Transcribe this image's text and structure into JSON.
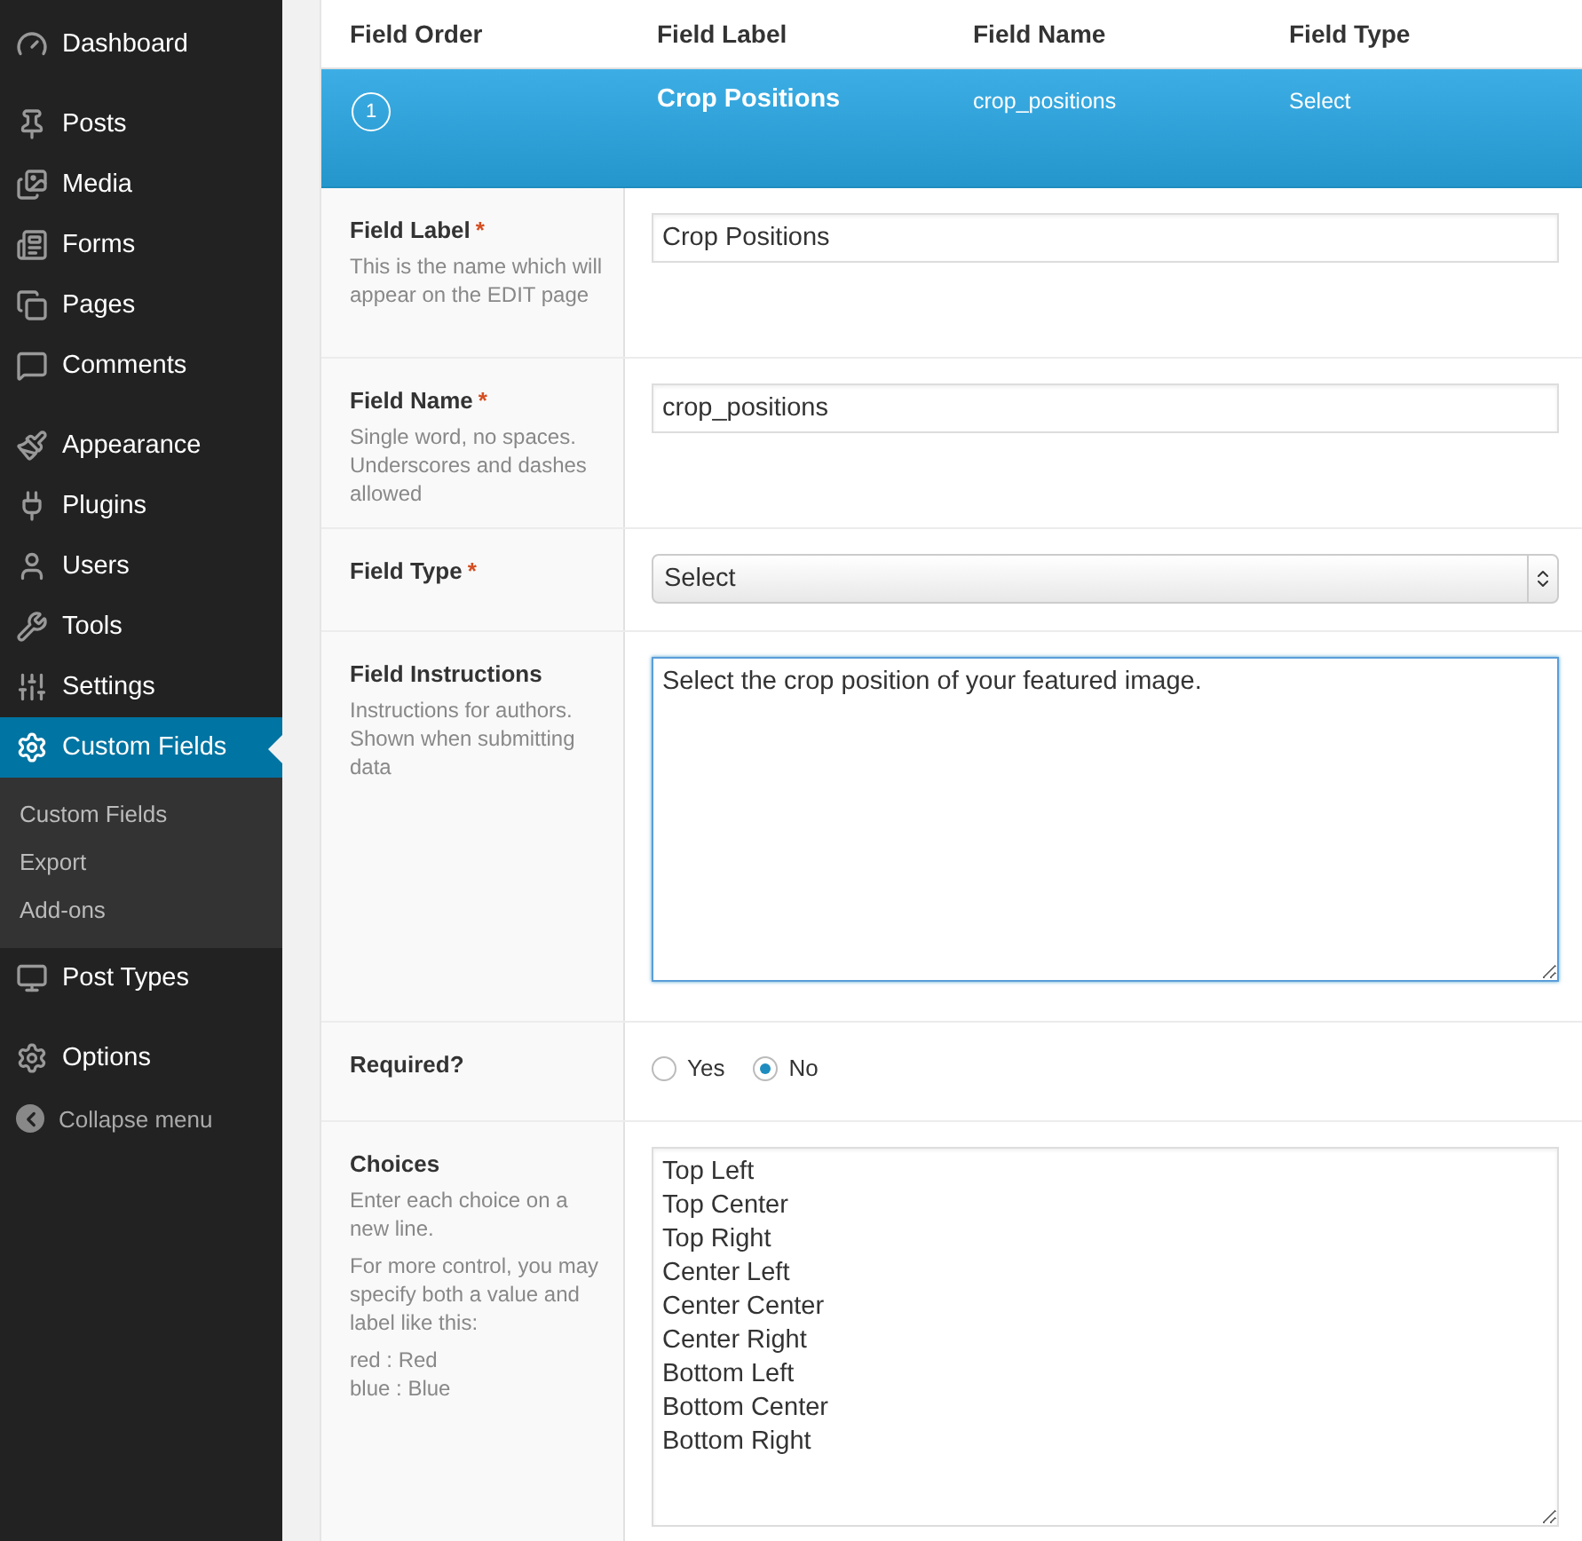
{
  "sidebar": {
    "groups": [
      [
        {
          "label": "Dashboard",
          "kind": "gauge",
          "selected": false
        }
      ],
      [
        {
          "label": "Posts",
          "kind": "pin",
          "selected": false
        },
        {
          "label": "Media",
          "kind": "media",
          "selected": false
        },
        {
          "label": "Forms",
          "kind": "form",
          "selected": false
        },
        {
          "label": "Pages",
          "kind": "pages",
          "selected": false
        },
        {
          "label": "Comments",
          "kind": "comment",
          "selected": false
        }
      ],
      [
        {
          "label": "Appearance",
          "kind": "brush",
          "selected": false
        },
        {
          "label": "Plugins",
          "kind": "plug",
          "selected": false
        },
        {
          "label": "Users",
          "kind": "user",
          "selected": false
        },
        {
          "label": "Tools",
          "kind": "wrench",
          "selected": false
        },
        {
          "label": "Settings",
          "kind": "sliders",
          "selected": false
        },
        {
          "label": "Custom Fields",
          "kind": "gear",
          "selected": true,
          "children": [
            {
              "label": "Custom Fields",
              "selected": false
            },
            {
              "label": "Export",
              "selected": false
            },
            {
              "label": "Add-ons",
              "selected": false
            }
          ]
        },
        {
          "label": "Post Types",
          "kind": "screen",
          "selected": false
        }
      ],
      [
        {
          "label": "Options",
          "kind": "gear",
          "selected": false
        }
      ]
    ],
    "collapse": "Collapse menu"
  },
  "fields_table": {
    "columns": [
      "Field Order",
      "Field Label",
      "Field Name",
      "Field Type"
    ],
    "open_field": {
      "order": "1",
      "label": "Crop Positions",
      "name": "crop_positions",
      "type": "Select"
    }
  },
  "form": [
    {
      "kind": "text",
      "label": "Field Label",
      "required_mark": "*",
      "description": [
        "This is the name which will appear on the EDIT page"
      ],
      "value": "Crop Positions"
    },
    {
      "kind": "text",
      "label": "Field Name",
      "required_mark": "*",
      "description": [
        "Single word, no spaces. Underscores and dashes allowed"
      ],
      "value": "crop_positions"
    },
    {
      "kind": "select",
      "label": "Field Type",
      "required_mark": "*",
      "value": "Select"
    },
    {
      "kind": "textarea",
      "label": "Field Instructions",
      "description": [
        "Instructions for authors. Shown when submitting data"
      ],
      "value": "Select the crop position of your featured image.",
      "focused": true
    },
    {
      "kind": "radio",
      "label": "Required?",
      "options": [
        {
          "label": "Yes",
          "selected": false
        },
        {
          "label": "No",
          "selected": true
        }
      ]
    },
    {
      "kind": "lines",
      "label": "Choices",
      "description": [
        "Enter each choice on a new line.",
        "For more control, you may specify both a value and label like this:",
        "red : Red\nblue : Blue"
      ],
      "lines": [
        "Top Left",
        "Top Center",
        "Top Right",
        "Center Left",
        "Center Center",
        "Center Right",
        "Bottom Left",
        "Bottom Center",
        "Bottom Right"
      ]
    }
  ]
}
